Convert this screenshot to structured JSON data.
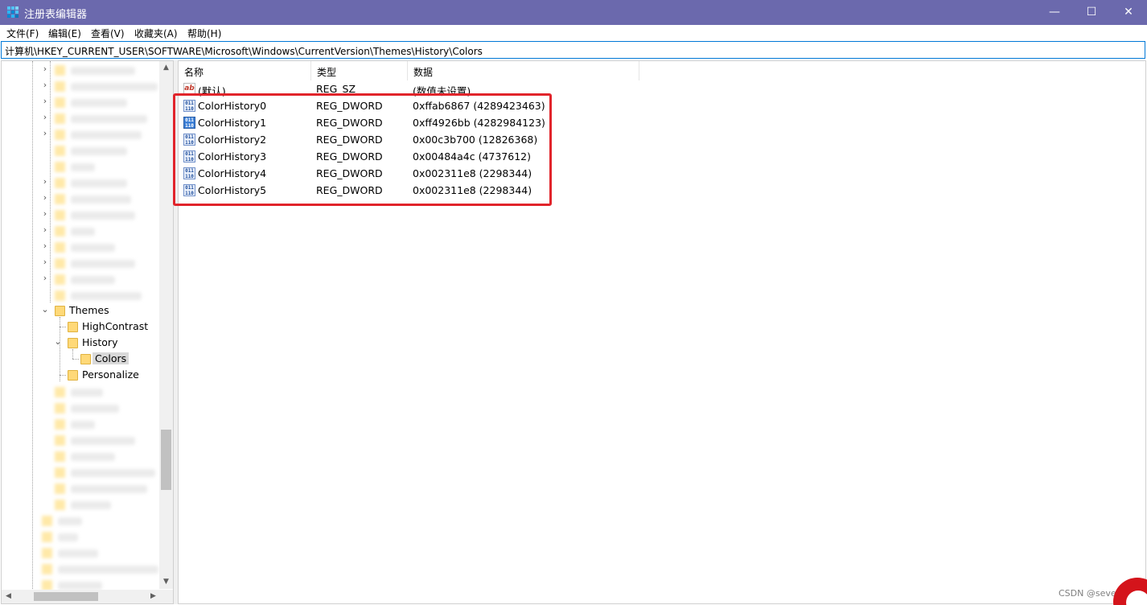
{
  "window": {
    "title": "注册表编辑器",
    "minimize": "—",
    "maximize": "☐",
    "close": "✕"
  },
  "menu": [
    "文件(F)",
    "编辑(E)",
    "查看(V)",
    "收藏夹(A)",
    "帮助(H)"
  ],
  "address": "计算机\\HKEY_CURRENT_USER\\SOFTWARE\\Microsoft\\Windows\\CurrentVersion\\Themes\\History\\Colors",
  "tree": {
    "themes": "Themes",
    "high_contrast": "HighContrast",
    "history": "History",
    "colors": "Colors",
    "personalize": "Personalize",
    "expand_glyph": "›",
    "collapse_glyph": "⌄"
  },
  "columns": {
    "name": "名称",
    "type": "类型",
    "data": "数据"
  },
  "rows": [
    {
      "name": "(默认)",
      "type": "REG_SZ",
      "data": "(数值未设置)",
      "icon": "string-value-icon"
    },
    {
      "name": "ColorHistory0",
      "type": "REG_DWORD",
      "data": "0xffab6867 (4289423463)",
      "icon": "binary-value-icon"
    },
    {
      "name": "ColorHistory1",
      "type": "REG_DWORD",
      "data": "0xff4926bb (4282984123)",
      "icon": "binary-value-icon"
    },
    {
      "name": "ColorHistory2",
      "type": "REG_DWORD",
      "data": "0x00c3b700 (12826368)",
      "icon": "binary-value-icon"
    },
    {
      "name": "ColorHistory3",
      "type": "REG_DWORD",
      "data": "0x00484a4c (4737612)",
      "icon": "binary-value-icon"
    },
    {
      "name": "ColorHistory4",
      "type": "REG_DWORD",
      "data": "0x002311e8 (2298344)",
      "icon": "binary-value-icon"
    },
    {
      "name": "ColorHistory5",
      "type": "REG_DWORD",
      "data": "0x002311e8 (2298344)",
      "icon": "binary-value-icon"
    }
  ],
  "icons": {
    "string_glyph": "ab",
    "binary_glyph": "011\n110"
  },
  "watermark": "CSDN @sevenez",
  "colors": {
    "titlebar": "#6b69ad",
    "highlight": "#e1242b",
    "selection": "#d9d9d9"
  }
}
